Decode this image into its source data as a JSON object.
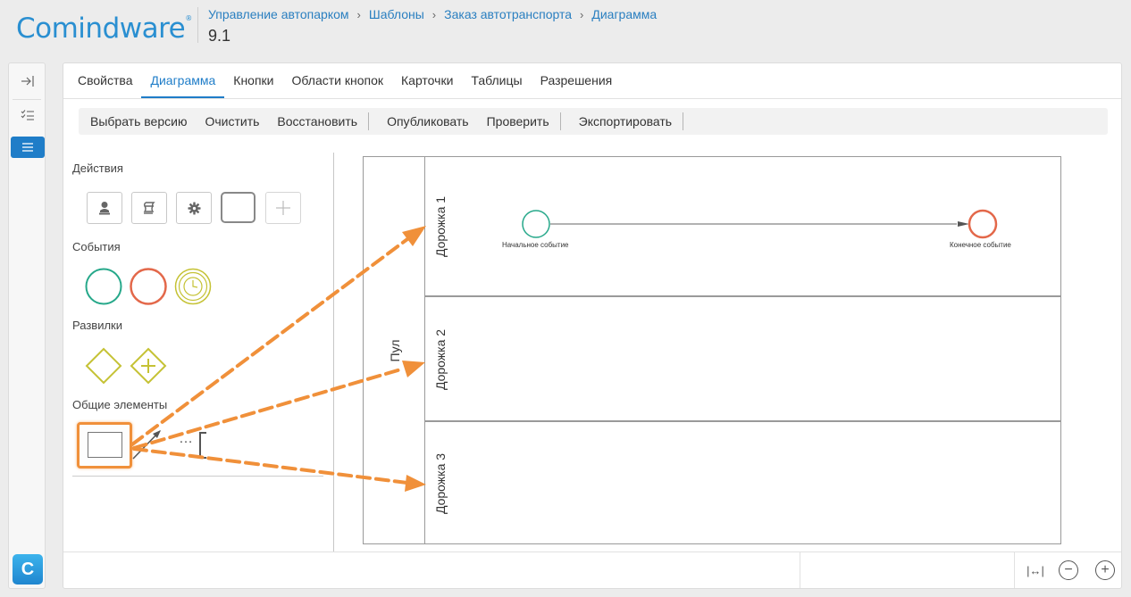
{
  "header": {
    "logo": "Comindware",
    "logo_mark": "®",
    "breadcrumb": [
      "Управление автопарком",
      "Шаблоны",
      "Заказ автотранспорта",
      "Диаграмма"
    ],
    "version": "9.1"
  },
  "rail": {
    "logo_letter": "C"
  },
  "tabs": [
    "Свойства",
    "Диаграмма",
    "Кнопки",
    "Области кнопок",
    "Карточки",
    "Таблицы",
    "Разрешения"
  ],
  "active_tab": "Диаграмма",
  "toolbar": {
    "select_version": "Выбрать версию",
    "clear": "Очистить",
    "restore": "Восстановить",
    "publish": "Опубликовать",
    "validate": "Проверить",
    "export": "Экспортировать"
  },
  "palette": {
    "actions_title": "Действия",
    "events_title": "События",
    "gateways_title": "Развилки",
    "common_title": "Общие элементы",
    "more_glyph": "…"
  },
  "diagram": {
    "pool_label": "Пул",
    "lanes": [
      "Дорожка 1",
      "Дорожка 2",
      "Дорожка 3"
    ],
    "start_event_label": "Начальное событие",
    "end_event_label": "Конечное событие"
  },
  "statusbar": {
    "fit_glyph": "|↔|",
    "zoom_out_glyph": "−",
    "zoom_in_glyph": "+"
  },
  "colors": {
    "accent": "#1f7dc8",
    "link": "#2a7fc0",
    "start_event": "#26a88a",
    "end_event": "#e3684a",
    "timer_gateway": "#c5c235",
    "annotation_arrow": "#f0903a"
  }
}
